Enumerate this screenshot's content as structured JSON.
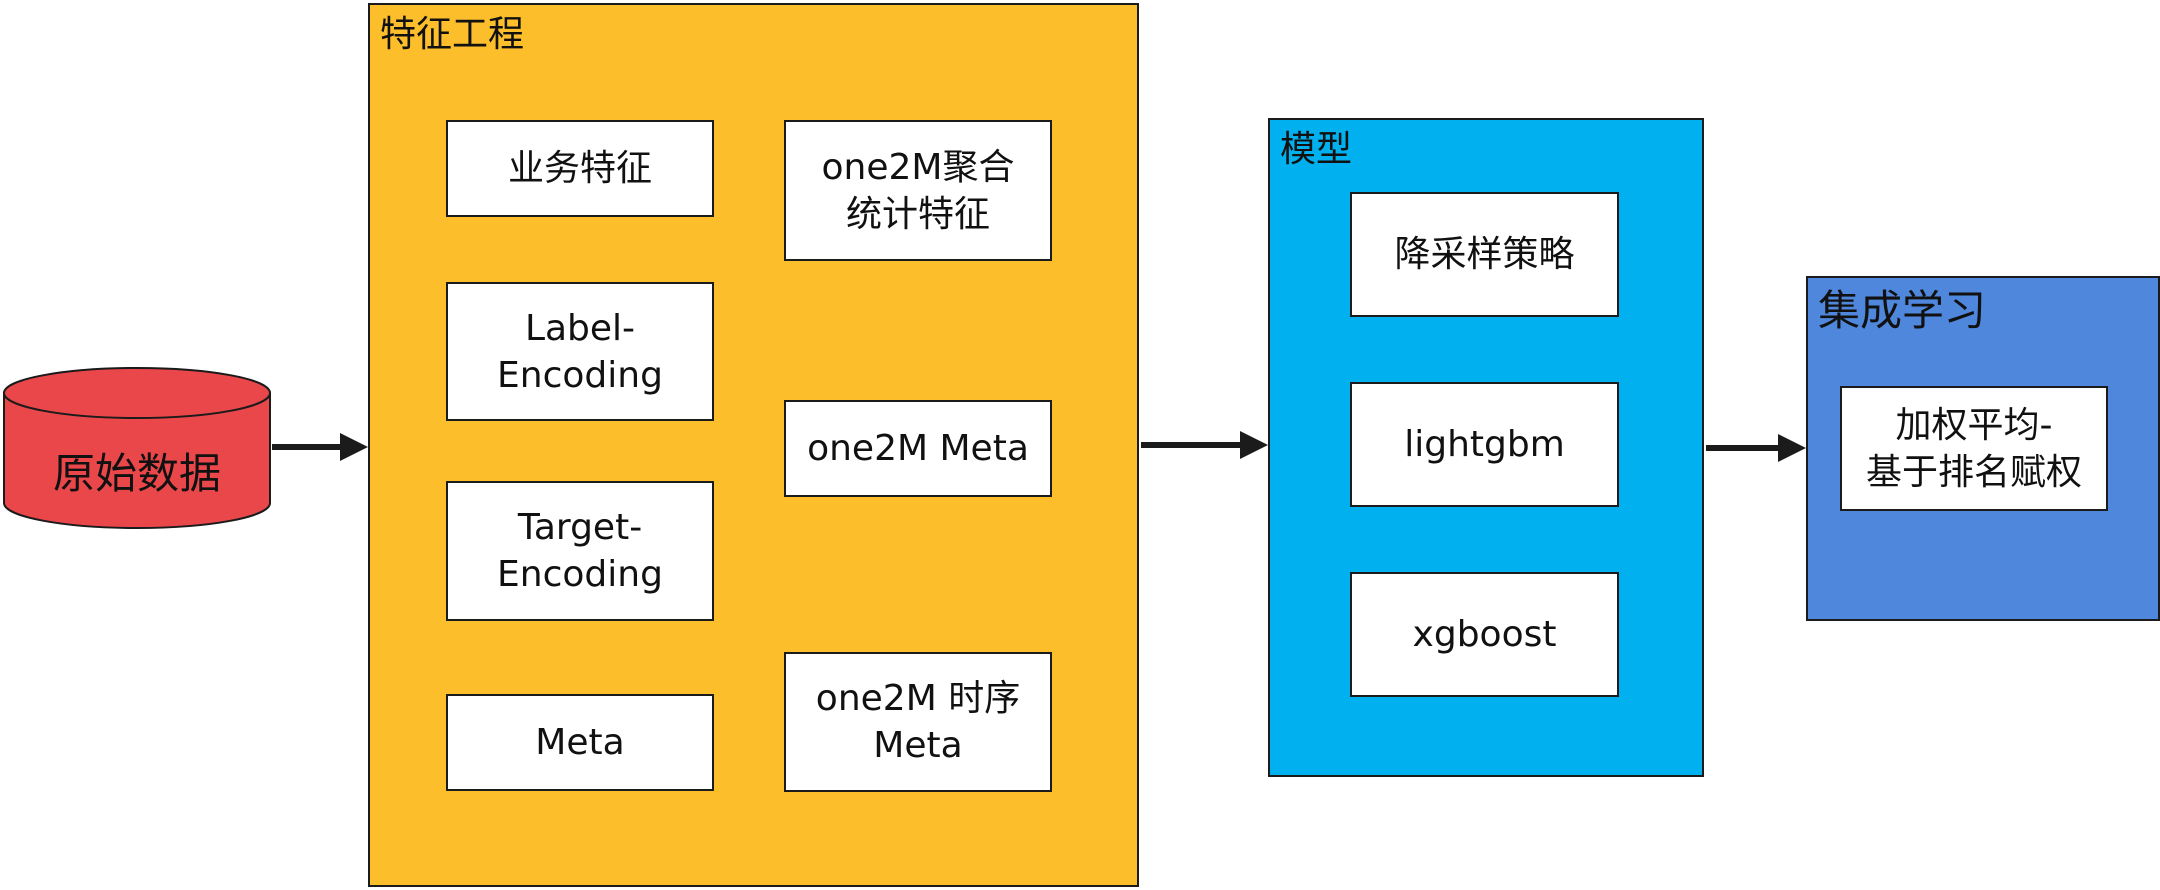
{
  "colors": {
    "feature_panel": "#FDBE2B",
    "model_panel": "#00B0EF",
    "ensemble_panel": "#4F87DD",
    "data_source": "#E9474A",
    "arrow": "#1b1b1b"
  },
  "data_source": {
    "label": "原始数据"
  },
  "feature_engineering": {
    "title": "特征工程",
    "items": [
      "业务特征",
      "Label-\nEncoding",
      "Target-\nEncoding",
      "Meta",
      "one2M聚合\n统计特征",
      "one2M Meta",
      "one2M 时序\nMeta"
    ]
  },
  "model": {
    "title": "模型",
    "items": [
      "降采样策略",
      "lightgbm",
      "xgboost"
    ]
  },
  "ensemble": {
    "title": "集成学习",
    "items": [
      "加权平均-\n基于排名赋权"
    ]
  }
}
